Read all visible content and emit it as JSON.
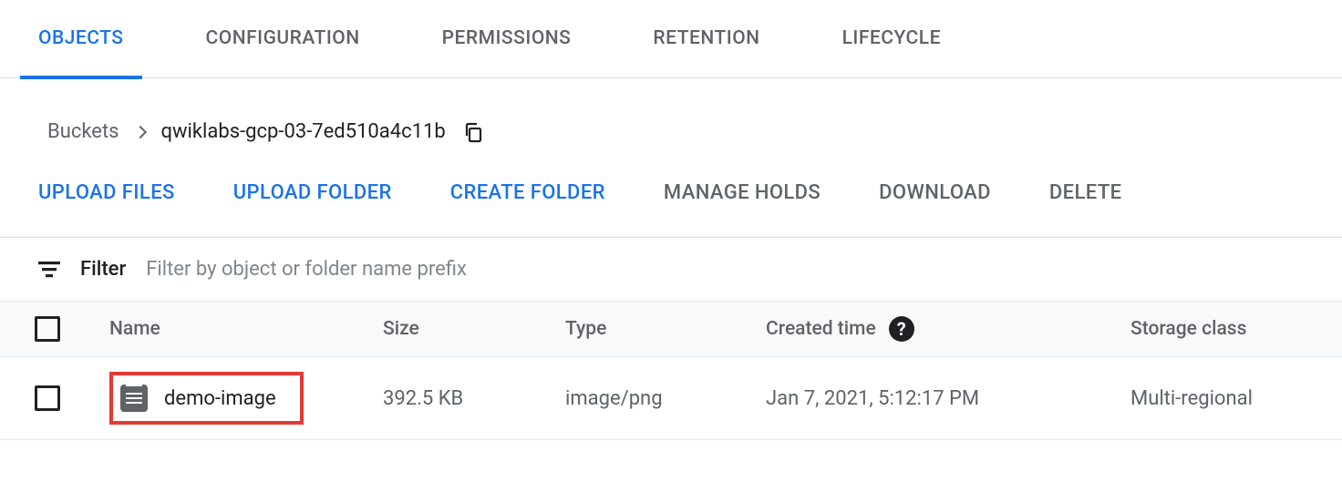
{
  "tabs": {
    "objects": "OBJECTS",
    "configuration": "CONFIGURATION",
    "permissions": "PERMISSIONS",
    "retention": "RETENTION",
    "lifecycle": "LIFECYCLE"
  },
  "breadcrumb": {
    "root": "Buckets",
    "current": "qwiklabs-gcp-03-7ed510a4c11b"
  },
  "toolbar": {
    "upload_files": "UPLOAD FILES",
    "upload_folder": "UPLOAD FOLDER",
    "create_folder": "CREATE FOLDER",
    "manage_holds": "MANAGE HOLDS",
    "download": "DOWNLOAD",
    "delete": "DELETE"
  },
  "filter": {
    "label": "Filter",
    "placeholder": "Filter by object or folder name prefix"
  },
  "table": {
    "headers": {
      "name": "Name",
      "size": "Size",
      "type": "Type",
      "created": "Created time",
      "storage_class": "Storage class"
    },
    "rows": [
      {
        "name": "demo-image",
        "size": "392.5 KB",
        "type": "image/png",
        "created": "Jan 7, 2021, 5:12:17 PM",
        "storage_class": "Multi-regional"
      }
    ]
  }
}
